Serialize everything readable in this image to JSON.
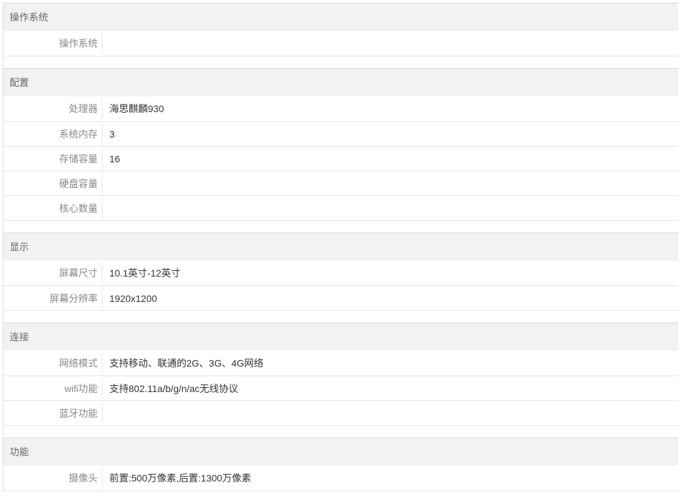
{
  "sections": [
    {
      "title": "操作系统",
      "rows": [
        {
          "label": "操作系统",
          "value": ""
        }
      ]
    },
    {
      "title": "配置",
      "rows": [
        {
          "label": "处理器",
          "value": "海思麒麟930"
        },
        {
          "label": "系统内存",
          "value": "3"
        },
        {
          "label": "存储容量",
          "value": "16"
        },
        {
          "label": "硬盘容量",
          "value": ""
        },
        {
          "label": "核心数量",
          "value": ""
        }
      ]
    },
    {
      "title": "显示",
      "rows": [
        {
          "label": "屏幕尺寸",
          "value": "10.1英寸-12英寸"
        },
        {
          "label": "屏幕分辨率",
          "value": "1920x1200"
        }
      ]
    },
    {
      "title": "连接",
      "rows": [
        {
          "label": "网络模式",
          "value": "支持移动、联通的2G、3G、4G网络"
        },
        {
          "label": "wifi功能",
          "value": "支持802.11a/b/g/n/ac无线协议"
        },
        {
          "label": "蓝牙功能",
          "value": ""
        }
      ]
    },
    {
      "title": "功能",
      "rows": [
        {
          "label": "摄像头",
          "value": "前置:500万像素,后置:1300万像素"
        }
      ]
    }
  ]
}
